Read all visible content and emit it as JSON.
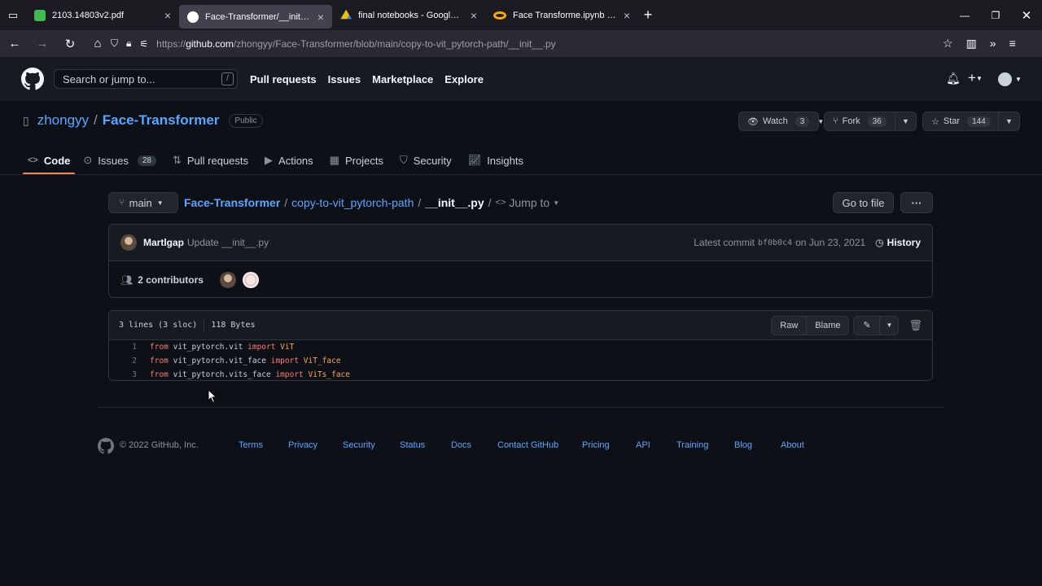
{
  "browser": {
    "tabs": [
      {
        "title": "2103.14803v2.pdf",
        "icon": "pdf-icon",
        "color": "#3fb950"
      },
      {
        "title": "Face-Transformer/__init__.py at",
        "icon": "github-icon",
        "color": "#ffffff"
      },
      {
        "title": "final notebooks - Google Drive",
        "icon": "drive-icon",
        "color": "#fbbc04"
      },
      {
        "title": "Face Transforme.ipynb - Colabo",
        "icon": "colab-icon",
        "color": "#f9ab00"
      }
    ],
    "url_prefix": "https://",
    "url_host": "github.com",
    "url_path": "/zhongyy/Face-Transformer/blob/main/copy-to-vit_pytorch-path/__init__.py"
  },
  "header": {
    "search_placeholder": "Search or jump to...",
    "slash_key": "/",
    "nav": [
      "Pull requests",
      "Issues",
      "Marketplace",
      "Explore"
    ],
    "plus": "+"
  },
  "repo": {
    "owner": "zhongyy",
    "separator": "/",
    "name": "Face-Transformer",
    "visibility": "Public",
    "watch_label": "Watch",
    "watch_count": "3",
    "fork_label": "Fork",
    "fork_count": "36",
    "star_label": "Star",
    "star_count": "144",
    "tabs": [
      {
        "label": "Code",
        "icon": "code-icon"
      },
      {
        "label": "Issues",
        "icon": "issue-icon",
        "count": "28"
      },
      {
        "label": "Pull requests",
        "icon": "pull-request-icon"
      },
      {
        "label": "Actions",
        "icon": "play-icon"
      },
      {
        "label": "Projects",
        "icon": "table-icon"
      },
      {
        "label": "Security",
        "icon": "shield-icon"
      },
      {
        "label": "Insights",
        "icon": "graph-icon"
      }
    ]
  },
  "file_nav": {
    "branch": "main",
    "repo_link": "Face-Transformer",
    "folder_link": "copy-to-vit_pytorch-path",
    "file": "__init__.py",
    "sep": "/",
    "jump_to": "Jump to",
    "go_to_file": "Go to file",
    "more": "···"
  },
  "commit": {
    "author": "Martlgap",
    "message": "Update __init__.py",
    "latest_label": "Latest commit",
    "sha": "bf0b0c4",
    "date": "on Jun 23, 2021",
    "history": "History",
    "contributors": "2 contributors"
  },
  "code": {
    "stats_lines": "3 lines (3 sloc)",
    "stats_size": "118 Bytes",
    "raw": "Raw",
    "blame": "Blame",
    "lines": [
      {
        "num": "1",
        "kw1": "from",
        "mod": " vit_pytorch.vit ",
        "kw2": "import",
        "cls": " ViT"
      },
      {
        "num": "2",
        "kw1": "from",
        "mod": " vit_pytorch.vit_face ",
        "kw2": "import",
        "cls": " ViT_face"
      },
      {
        "num": "3",
        "kw1": "from",
        "mod": " vit_pytorch.vits_face ",
        "kw2": "import",
        "cls": " ViTs_face"
      }
    ]
  },
  "footer": {
    "copyright": "© 2022 GitHub, Inc.",
    "links": [
      "Terms",
      "Privacy",
      "Security",
      "Status",
      "Docs",
      "Contact GitHub",
      "Pricing",
      "API",
      "Training",
      "Blog",
      "About"
    ]
  }
}
